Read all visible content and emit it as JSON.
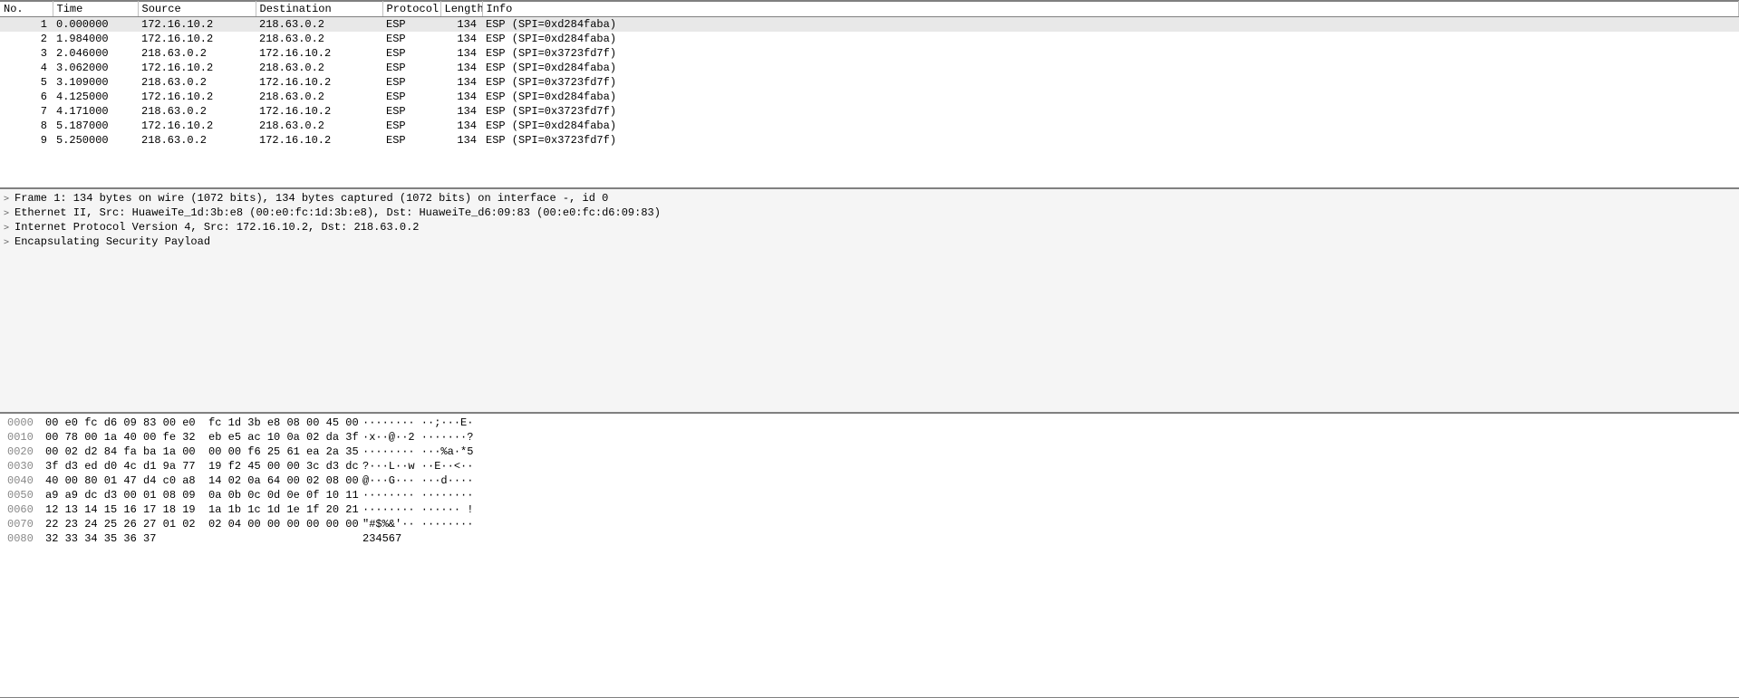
{
  "columns": {
    "no": "No.",
    "time": "Time",
    "source": "Source",
    "destination": "Destination",
    "protocol": "Protocol",
    "length": "Length",
    "info": "Info"
  },
  "packets": [
    {
      "no": "1",
      "time": "0.000000",
      "src": "172.16.10.2",
      "dst": "218.63.0.2",
      "proto": "ESP",
      "len": "134",
      "info": "ESP (SPI=0xd284faba)",
      "selected": true
    },
    {
      "no": "2",
      "time": "1.984000",
      "src": "172.16.10.2",
      "dst": "218.63.0.2",
      "proto": "ESP",
      "len": "134",
      "info": "ESP (SPI=0xd284faba)"
    },
    {
      "no": "3",
      "time": "2.046000",
      "src": "218.63.0.2",
      "dst": "172.16.10.2",
      "proto": "ESP",
      "len": "134",
      "info": "ESP (SPI=0x3723fd7f)"
    },
    {
      "no": "4",
      "time": "3.062000",
      "src": "172.16.10.2",
      "dst": "218.63.0.2",
      "proto": "ESP",
      "len": "134",
      "info": "ESP (SPI=0xd284faba)"
    },
    {
      "no": "5",
      "time": "3.109000",
      "src": "218.63.0.2",
      "dst": "172.16.10.2",
      "proto": "ESP",
      "len": "134",
      "info": "ESP (SPI=0x3723fd7f)"
    },
    {
      "no": "6",
      "time": "4.125000",
      "src": "172.16.10.2",
      "dst": "218.63.0.2",
      "proto": "ESP",
      "len": "134",
      "info": "ESP (SPI=0xd284faba)"
    },
    {
      "no": "7",
      "time": "4.171000",
      "src": "218.63.0.2",
      "dst": "172.16.10.2",
      "proto": "ESP",
      "len": "134",
      "info": "ESP (SPI=0x3723fd7f)"
    },
    {
      "no": "8",
      "time": "5.187000",
      "src": "172.16.10.2",
      "dst": "218.63.0.2",
      "proto": "ESP",
      "len": "134",
      "info": "ESP (SPI=0xd284faba)"
    },
    {
      "no": "9",
      "time": "5.250000",
      "src": "218.63.0.2",
      "dst": "172.16.10.2",
      "proto": "ESP",
      "len": "134",
      "info": "ESP (SPI=0x3723fd7f)"
    }
  ],
  "details": [
    "Frame 1: 134 bytes on wire (1072 bits), 134 bytes captured (1072 bits) on interface -, id 0",
    "Ethernet II, Src: HuaweiTe_1d:3b:e8 (00:e0:fc:1d:3b:e8), Dst: HuaweiTe_d6:09:83 (00:e0:fc:d6:09:83)",
    "Internet Protocol Version 4, Src: 172.16.10.2, Dst: 218.63.0.2",
    "Encapsulating Security Payload"
  ],
  "hex": [
    {
      "off": "0000",
      "b": "00 e0 fc d6 09 83 00 e0  fc 1d 3b e8 08 00 45 00",
      "a": "········ ··;···E·"
    },
    {
      "off": "0010",
      "b": "00 78 00 1a 40 00 fe 32  eb e5 ac 10 0a 02 da 3f",
      "a": "·x··@··2 ·······?"
    },
    {
      "off": "0020",
      "b": "00 02 d2 84 fa ba 1a 00  00 00 f6 25 61 ea 2a 35",
      "a": "········ ···%a·*5"
    },
    {
      "off": "0030",
      "b": "3f d3 ed d0 4c d1 9a 77  19 f2 45 00 00 3c d3 dc",
      "a": "?···L··w ··E··<··"
    },
    {
      "off": "0040",
      "b": "40 00 80 01 47 d4 c0 a8  14 02 0a 64 00 02 08 00",
      "a": "@···G··· ···d····"
    },
    {
      "off": "0050",
      "b": "a9 a9 dc d3 00 01 08 09  0a 0b 0c 0d 0e 0f 10 11",
      "a": "········ ········"
    },
    {
      "off": "0060",
      "b": "12 13 14 15 16 17 18 19  1a 1b 1c 1d 1e 1f 20 21",
      "a": "········ ······ !"
    },
    {
      "off": "0070",
      "b": "22 23 24 25 26 27 01 02  02 04 00 00 00 00 00 00",
      "a": "\"#$%&'·· ········"
    },
    {
      "off": "0080",
      "b": "32 33 34 35 36 37                               ",
      "a": "234567"
    }
  ]
}
